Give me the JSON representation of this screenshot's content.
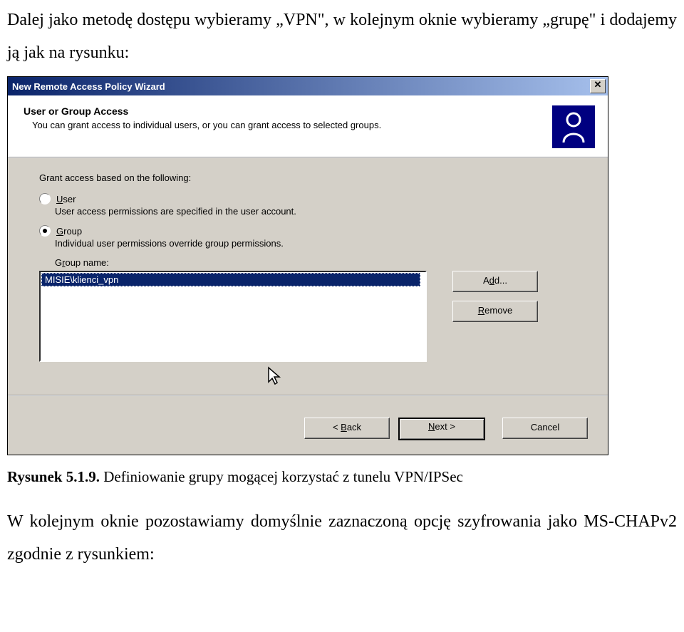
{
  "doc": {
    "intro": "Dalej jako metodę dostępu wybieramy „VPN\", w kolejnym oknie wybieramy „grupę\" i dodajemy ją jak na rysunku:",
    "caption_label": "Rysunek 5.1.9.",
    "caption_text": " Definiowanie grupy mogącej korzystać z tunelu VPN/IPSec",
    "outro": "W kolejnym oknie pozostawiamy domyślnie zaznaczoną opcję szyfrowania jako MS-CHAPv2 zgodnie z rysunkiem:"
  },
  "dialog": {
    "title": "New Remote Access Policy Wizard",
    "header_title": "User or Group Access",
    "header_desc": "You can grant access to individual users, or you can grant access to selected groups.",
    "grant_label": "Grant access based on the following:",
    "radio_user_label": "User",
    "radio_user_desc": "User access permissions are specified in the user account.",
    "radio_group_label": "Group",
    "radio_group_desc": "Individual user permissions override group permissions.",
    "group_name_label": "Group name:",
    "list_item": "MISIE\\klienci_vpn",
    "btn_add": "Add...",
    "btn_remove": "Remove",
    "btn_back": "< Back",
    "btn_next": "Next >",
    "btn_cancel": "Cancel"
  }
}
